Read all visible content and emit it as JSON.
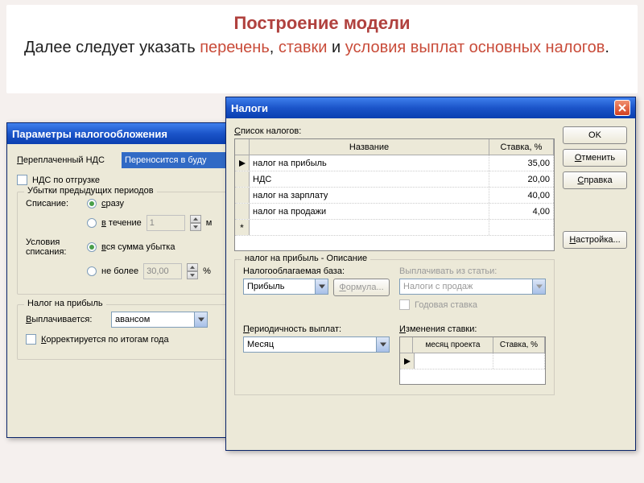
{
  "header": {
    "title": "Построение модели",
    "t1": "Далее следует указать ",
    "a1": "перечень",
    "t2": ", ",
    "a2": "ставки",
    "t3": " и ",
    "a3": "условия выплат основных налогов",
    "t4": "."
  },
  "win1": {
    "title": "Параметры налогообложения",
    "overpaid_label": "Переплаченный НДС",
    "overpaid_value": "Переносится в буду",
    "vat_ship": "НДС по отгрузке",
    "losses_group": "Убытки предыдущих периодов",
    "writeoff_label": "Списание:",
    "writeoff_opt1": "сразу",
    "writeoff_opt2": "в течение",
    "writeoff_months": "1",
    "writeoff_unit": "м",
    "cond_label": "Условия списания:",
    "cond_opt1": "вся сумма убытка",
    "cond_opt2": "не более",
    "cond_value": "30,00",
    "cond_unit": "%",
    "profit_group": "Налог на прибыль",
    "paid_label": "Выплачивается:",
    "paid_value": "авансом",
    "corrected": "Корректируется по итогам года"
  },
  "win2": {
    "title": "Налоги",
    "list_label": "Список налогов:",
    "columns": {
      "name": "Название",
      "rate": "Ставка, %"
    },
    "rows": [
      {
        "name": "налог на прибыль",
        "rate": "35,00"
      },
      {
        "name": "НДС",
        "rate": "20,00"
      },
      {
        "name": "налог на зарплату",
        "rate": "40,00"
      },
      {
        "name": "налог на продажи",
        "rate": "4,00"
      }
    ],
    "buttons": {
      "ok": "OK",
      "cancel": "Отменить",
      "help": "Справка",
      "settings": "Настройка..."
    },
    "desc_legend": "налог на прибыль - Описание",
    "base_label": "Налогооблагаемая база:",
    "base_value": "Прибыль",
    "formula": "Формула...",
    "payfrom_label": "Выплачивать из статьи:",
    "payfrom_value": "Налоги с продаж",
    "annual_rate": "Годовая ставка",
    "period_label": "Периодичность выплат:",
    "period_value": "Месяц",
    "changes_label": "Изменения ставки:",
    "changes_cols": {
      "month": "месяц проекта",
      "rate": "Ставка, %"
    }
  }
}
